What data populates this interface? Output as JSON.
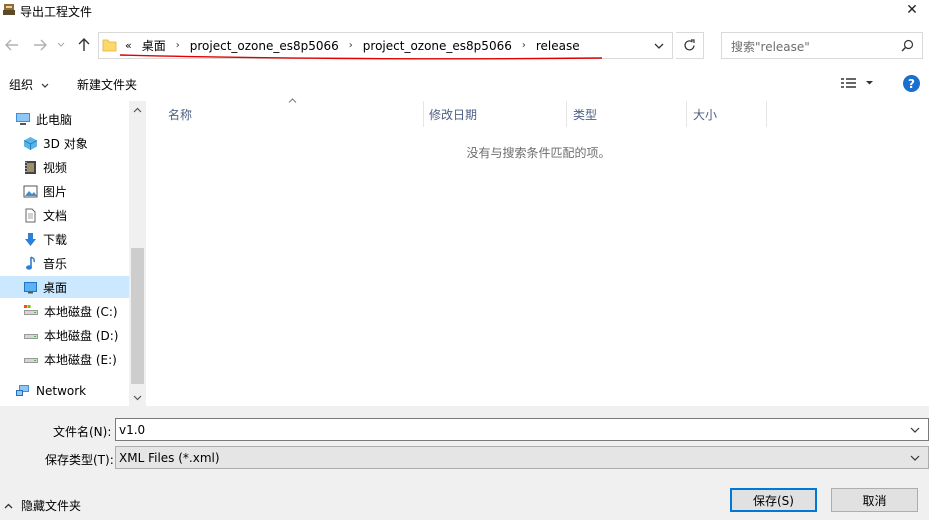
{
  "window": {
    "title": "导出工程文件"
  },
  "address": {
    "overflow": "«",
    "crumbs": [
      "桌面",
      "project_ozone_es8p5066",
      "project_ozone_es8p5066",
      "release"
    ]
  },
  "search": {
    "placeholder": "搜索\"release\""
  },
  "toolbar": {
    "organize": "组织",
    "new_folder": "新建文件夹"
  },
  "nav": {
    "this_pc": "此电脑",
    "items": [
      {
        "label": "3D 对象",
        "icon": "cube-icon"
      },
      {
        "label": "视频",
        "icon": "video-icon"
      },
      {
        "label": "图片",
        "icon": "picture-icon"
      },
      {
        "label": "文档",
        "icon": "document-icon"
      },
      {
        "label": "下载",
        "icon": "download-icon"
      },
      {
        "label": "音乐",
        "icon": "music-icon"
      },
      {
        "label": "桌面",
        "icon": "desktop-icon"
      },
      {
        "label": "本地磁盘 (C:)",
        "icon": "drive-icon"
      },
      {
        "label": "本地磁盘 (D:)",
        "icon": "drive-icon"
      },
      {
        "label": "本地磁盘 (E:)",
        "icon": "drive-icon"
      }
    ],
    "network": "Network",
    "selected": "桌面"
  },
  "columns": {
    "name": "名称",
    "modified": "修改日期",
    "type": "类型",
    "size": "大小"
  },
  "empty_message": "没有与搜索条件匹配的项。",
  "bottom": {
    "filename_label": "文件名(N):",
    "filename_value": "v1.0",
    "filetype_label": "保存类型(T):",
    "filetype_value": "XML Files (*.xml)",
    "hide_folders": "隐藏文件夹",
    "save": "保存(S)",
    "cancel": "取消"
  },
  "colors": {
    "accent": "#0078d7",
    "selected_bg": "#cce8ff",
    "help": "#1a6fd0",
    "annotation": "#e00000"
  }
}
